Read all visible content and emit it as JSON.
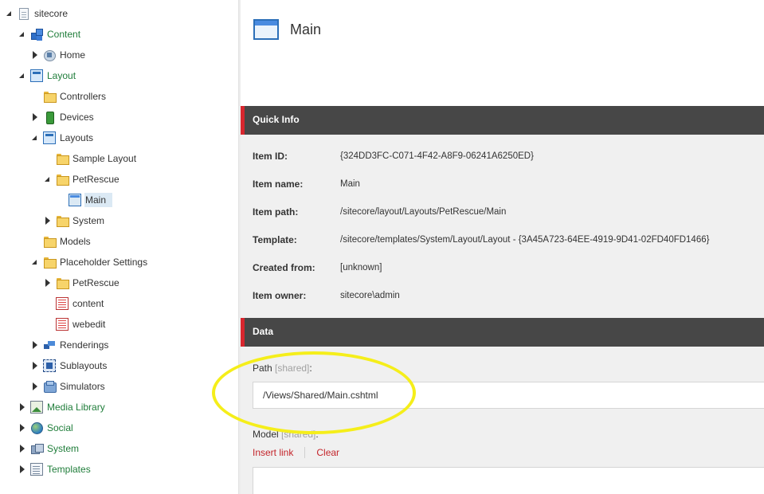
{
  "tree": {
    "sitecore": "sitecore",
    "content": "Content",
    "home": "Home",
    "layout": "Layout",
    "controllers": "Controllers",
    "devices": "Devices",
    "layouts": "Layouts",
    "sample_layout": "Sample Layout",
    "petrescue": "PetRescue",
    "main": "Main",
    "system_layouts": "System",
    "models": "Models",
    "placeholder_settings": "Placeholder Settings",
    "ph_petrescue": "PetRescue",
    "ph_content": "content",
    "ph_webedit": "webedit",
    "renderings": "Renderings",
    "sublayouts": "Sublayouts",
    "simulators": "Simulators",
    "media_library": "Media Library",
    "social": "Social",
    "system": "System",
    "templates": "Templates"
  },
  "header": {
    "title": "Main"
  },
  "quick_info": {
    "section_title": "Quick Info",
    "rows": [
      {
        "label": "Item ID:",
        "value": "{324DD3FC-C071-4F42-A8F9-06241A6250ED}"
      },
      {
        "label": "Item name:",
        "value": "Main"
      },
      {
        "label": "Item path:",
        "value": "/sitecore/layout/Layouts/PetRescue/Main"
      },
      {
        "label": "Template:",
        "value": "/sitecore/templates/System/Layout/Layout - {3A45A723-64EE-4919-9D41-02FD40FD1466}"
      },
      {
        "label": "Created from:",
        "value": "[unknown]"
      },
      {
        "label": "Item owner:",
        "value": "sitecore\\admin"
      }
    ]
  },
  "data_section": {
    "section_title": "Data",
    "path_label": "Path",
    "path_shared": "[shared]",
    "path_colon": ":",
    "path_value": "/Views/Shared/Main.cshtml",
    "model_label": "Model",
    "model_shared": "[shared]",
    "model_colon": ":",
    "insert_link": "Insert link",
    "clear": "Clear"
  },
  "colors": {
    "accent": "#d8262e",
    "section_bar": "#474747",
    "link": "#c4252b",
    "highlight": "#f5ee1a",
    "tree_green": "#1f7d3a"
  }
}
